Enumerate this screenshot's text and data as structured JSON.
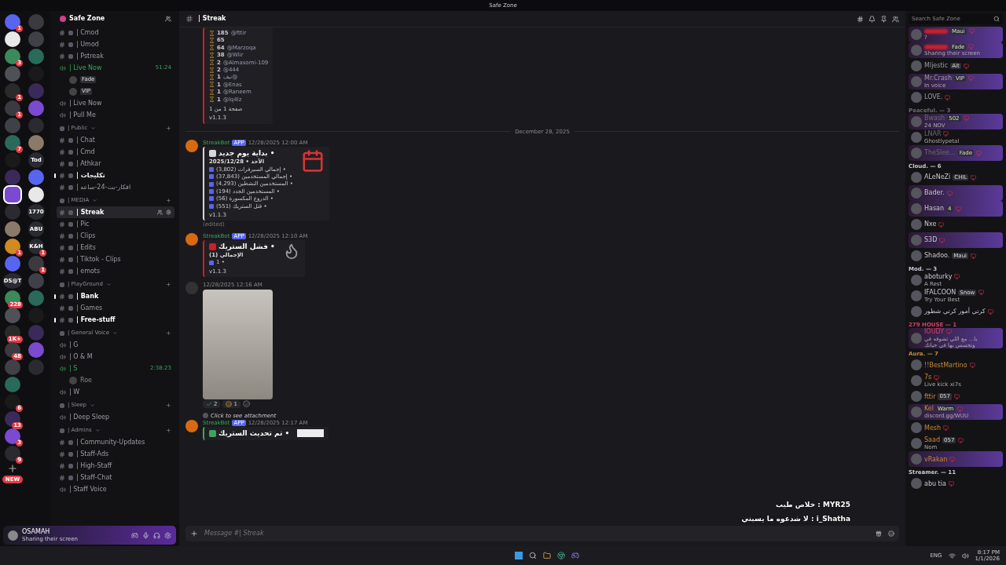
{
  "window": {
    "title": "Safe Zone"
  },
  "server_rail": {
    "left": [
      {
        "badge": "1",
        "selected": false
      },
      {
        "selected": false
      },
      {
        "badge": "3",
        "selected": false
      },
      {
        "selected": false
      },
      {
        "badge": "1",
        "selected": false
      },
      {
        "badge": "1",
        "selected": false
      },
      {
        "selected": false
      },
      {
        "badge": "7",
        "selected": false
      },
      {
        "selected": false
      },
      {
        "selected": false
      },
      {
        "selected": true
      },
      {
        "selected": false
      },
      {
        "selected": false
      },
      {
        "badge": "1",
        "selected": false
      },
      {
        "selected": false
      },
      {
        "label": "DS@T",
        "selected": false
      },
      {
        "badge": "228",
        "selected": false
      },
      {
        "selected": false
      },
      {
        "badge": "1K+",
        "selected": false
      },
      {
        "badge": "48",
        "selected": false
      },
      {
        "selected": false
      },
      {
        "selected": false
      },
      {
        "badge": "6",
        "selected": false
      },
      {
        "badge": "13",
        "selected": false
      },
      {
        "badge": "3",
        "selected": false
      },
      {
        "badge": "9",
        "selected": false
      }
    ],
    "right": [
      {
        "selected": false
      },
      {
        "selected": false
      },
      {
        "selected": false
      },
      {
        "selected": false
      },
      {
        "selected": false
      },
      {
        "selected": false
      },
      {
        "selected": false
      },
      {
        "selected": false
      },
      {
        "label": "Tod",
        "selected": false
      },
      {
        "selected": false
      },
      {
        "selected": false
      },
      {
        "label": "1770",
        "selected": false
      },
      {
        "label": "ABU",
        "selected": false
      },
      {
        "label": "K&H",
        "badge": "1",
        "selected": false
      },
      {
        "badge": "1",
        "selected": false
      },
      {
        "selected": false
      },
      {
        "selected": false
      },
      {
        "selected": false
      },
      {
        "selected": false
      },
      {
        "selected": false
      },
      {
        "selected": false
      }
    ],
    "new_label": "NEW"
  },
  "server": {
    "name": "Safe Zone"
  },
  "channels": [
    {
      "kind": "text",
      "name": "| Cmod",
      "unread": false,
      "selected": false
    },
    {
      "kind": "text",
      "name": "| Umod",
      "unread": false,
      "selected": false
    },
    {
      "kind": "text",
      "name": "| Pstreak",
      "unread": false,
      "selected": false
    },
    {
      "kind": "voice",
      "name": "| Live Now",
      "live": true,
      "timer": "51:24"
    },
    {
      "kind": "member",
      "badge": "Fade"
    },
    {
      "kind": "member",
      "badge": "VIP"
    },
    {
      "kind": "voice",
      "name": "| Live Now",
      "live": false
    },
    {
      "kind": "voice",
      "name": "| Pull Me",
      "live": false
    },
    {
      "kind": "category",
      "name": "| Public"
    },
    {
      "kind": "text",
      "name": "| Chat",
      "unread": false,
      "selected": false
    },
    {
      "kind": "text",
      "name": "| Cmd",
      "unread": false,
      "selected": false
    },
    {
      "kind": "text",
      "name": "| Athkar",
      "unread": false,
      "selected": false
    },
    {
      "kind": "text",
      "name": "| تكليجات",
      "unread": true,
      "selected": false
    },
    {
      "kind": "text",
      "name": "| افكار-بث-24-ساعه",
      "unread": false,
      "selected": false
    },
    {
      "kind": "category",
      "name": "| MEDIA"
    },
    {
      "kind": "text",
      "name": "| Streak",
      "unread": false,
      "selected": true
    },
    {
      "kind": "text",
      "name": "| Pic",
      "unread": false,
      "selected": false
    },
    {
      "kind": "text",
      "name": "| Clips",
      "unread": false,
      "selected": false
    },
    {
      "kind": "text",
      "name": "| Edits",
      "unread": false,
      "selected": false
    },
    {
      "kind": "text",
      "name": "| Tiktok - Clips",
      "unread": false,
      "selected": false
    },
    {
      "kind": "text",
      "name": "| emots",
      "unread": false,
      "selected": false
    },
    {
      "kind": "category",
      "name": "| PlayGround"
    },
    {
      "kind": "text",
      "name": "| Bank",
      "unread": true,
      "selected": false
    },
    {
      "kind": "text",
      "name": "| Games",
      "unread": false,
      "selected": false
    },
    {
      "kind": "text",
      "name": "| Free-stuff",
      "unread": true,
      "selected": false
    },
    {
      "kind": "category",
      "name": "| General Voice"
    },
    {
      "kind": "voice",
      "name": "| G",
      "live": false
    },
    {
      "kind": "voice",
      "name": "| O & M",
      "live": false
    },
    {
      "kind": "voice",
      "name": "| S",
      "live": true,
      "timer": "2:38:23"
    },
    {
      "kind": "member",
      "name": "Roe"
    },
    {
      "kind": "voice",
      "name": "| W",
      "live": false
    },
    {
      "kind": "category",
      "name": "| Sleep"
    },
    {
      "kind": "voice",
      "name": "| Deep Sleep",
      "live": false
    },
    {
      "kind": "category",
      "name": "| Admins"
    },
    {
      "kind": "text",
      "name": "| Community-Updates",
      "unread": false,
      "selected": false
    },
    {
      "kind": "text",
      "name": "| Staff-Ads",
      "unread": false,
      "selected": false
    },
    {
      "kind": "text",
      "name": "| High-Staff",
      "unread": false,
      "selected": false
    },
    {
      "kind": "text",
      "name": "| Staff-Chat",
      "unread": false,
      "selected": false
    },
    {
      "kind": "voice",
      "name": "| Staff Voice",
      "live": false
    }
  ],
  "user": {
    "name": "OSAMAH",
    "status": "Sharing their screen"
  },
  "channel_header": {
    "name": "| Streak"
  },
  "search": {
    "placeholder": "Search Safe Zone"
  },
  "messages": [
    {
      "kind": "continued",
      "embed": {
        "color": "#c8202c",
        "rows": [
          {
            "count": "185",
            "name": "@fttir"
          },
          {
            "count": "65"
          },
          {
            "count": "64",
            "name": "@Marzoqa"
          },
          {
            "count": "38",
            "name": "@Wlir"
          },
          {
            "count": "2",
            "name": "@Almasomi-109"
          },
          {
            "count": "2",
            "name": "@444"
          },
          {
            "count": "1",
            "name": "نيف@"
          },
          {
            "count": "1",
            "name": "@Enas"
          },
          {
            "count": "1",
            "name": "@Raneem"
          },
          {
            "count": "1",
            "name": "@lq4lz"
          }
        ],
        "footer": "صفحة 1 من 1",
        "version": "v1.1.3"
      }
    },
    {
      "kind": "divider",
      "text": "December 28, 2025"
    },
    {
      "kind": "bot",
      "author": "StreakBot",
      "tag": "APP",
      "time": "12/28/2025 12:00 AM",
      "edited": "(edited)",
      "embed": {
        "color": "#d8d8dc",
        "kind": "calendar",
        "title": "بداية يوم جديد •",
        "subtitle": "الأحد • 2025/12/28",
        "lines": [
          "إجمالي السيرفرات (3,802) •",
          "إجمالي المستخدمين (37,843) •",
          "المستخدمين النشطين (4,293) •",
          "المستخدمين الجدد (194) •",
          "الدروع المكسورة (56) •",
          "قتل الستريك (551) •"
        ],
        "version": "v1.1.3"
      }
    },
    {
      "kind": "bot",
      "author": "StreakBot",
      "tag": "APP",
      "time": "12/28/2025 12:10 AM",
      "embed": {
        "color": "#c8202c",
        "kind": "fire",
        "title": "فشل الستريك •",
        "subtitle": "الإجمالي (1)",
        "lines": [
          "1 •"
        ],
        "version": "v1.1.3"
      }
    },
    {
      "kind": "image",
      "time": "12/28/2025 12:16 AM",
      "reactions": [
        {
          "count": "2"
        },
        {
          "count": "1"
        }
      ]
    },
    {
      "kind": "bot",
      "reply": "Click to see attachment",
      "author": "StreakBot",
      "tag": "APP",
      "time": "12/28/2025 12:17 AM",
      "embed": {
        "color": "#3ba55c",
        "kind": "photo",
        "title": "تم تحديث الستريك •"
      }
    }
  ],
  "composer": {
    "placeholder": "Message #| Streak"
  },
  "overlay": [
    "خلاص طيب : MYR25",
    "لا شدعوه ما يسبني : i_Shatha"
  ],
  "member_groups": [
    {
      "color": "#c8202c",
      "members": [
        {
          "badge": "Maui",
          "sub": "?",
          "plate": true
        },
        {
          "badge": "Fade",
          "sub": "Sharing their screen",
          "plate": true
        }
      ]
    },
    {
      "color": "#9a9aa2",
      "members": [
        {
          "name": "Mljestic",
          "badge": "Ait",
          "plate": false
        },
        {
          "name": "Mr.Crash",
          "badge": "VIP",
          "sub": "In voice",
          "plate": true
        },
        {
          "name": "LOVE.",
          "plate": false
        }
      ]
    },
    {
      "title": "Peaceful. — 3",
      "color": "#6a6a72",
      "members": [
        {
          "name": "Bwash",
          "badge": "502",
          "sub": "24 NOV",
          "plate": true
        },
        {
          "name": "LNAR",
          "sub": "Ghostlypetal",
          "plate": false
        },
        {
          "name": "TheSlee...",
          "badge": "Fade",
          "plate": true
        }
      ]
    },
    {
      "title": "Cloud. — 6",
      "color": "#c9c9d0",
      "members": [
        {
          "name": "ALeNeZi",
          "badge": "CHIL",
          "plate": false
        },
        {
          "name": "Bader.",
          "plate": true
        },
        {
          "name": "Hasan",
          "badge": "4",
          "plate": true
        },
        {
          "name": "Nxe",
          "plate": false
        },
        {
          "name": "S3D",
          "plate": true
        },
        {
          "name": "Shadoo.",
          "badge": "Maui",
          "plate": false
        }
      ]
    },
    {
      "title": "Mod. — 3",
      "color": "#c9c9d0",
      "members": [
        {
          "name": "aboturky",
          "sub": "A Rest",
          "plate": false
        },
        {
          "name": "IFALCOON",
          "badge": "Snow",
          "sub": "Try Your Best",
          "plate": false
        },
        {
          "name": "كرتي أمور كرتي شطور",
          "plate": false
        }
      ]
    },
    {
      "title": "279 HOUSE — 1",
      "color": "#d0406a",
      "members": [
        {
          "name": "IOUDY",
          "sub": "يا... مع اللي تشوفه في وتحسس بها في حياتك",
          "plate": true
        }
      ]
    },
    {
      "title": "Aura. — 7",
      "color": "#c88a3a",
      "members": [
        {
          "name": "!!BestMartino",
          "plate": false
        },
        {
          "name": "7s",
          "sub": "Live kick xi7s",
          "plate": false
        },
        {
          "name": "fttir",
          "badge": "057",
          "plate": false
        },
        {
          "name": "Kel",
          "badge": "Warm",
          "sub": "discord.gg/WUU",
          "plate": true
        },
        {
          "name": "Mesh",
          "plate": false
        },
        {
          "name": "Saad",
          "badge": "057",
          "sub": "Nom",
          "plate": false
        },
        {
          "name": "vRakan",
          "plate": true
        }
      ]
    },
    {
      "title": "Streamer. — 11",
      "color": "#c9c9d0",
      "members": [
        {
          "name": "abu tia",
          "plate": false
        }
      ]
    }
  ],
  "taskbar": {
    "language": "ENG",
    "time": "8:17 PM",
    "date": "1/1/2026"
  }
}
